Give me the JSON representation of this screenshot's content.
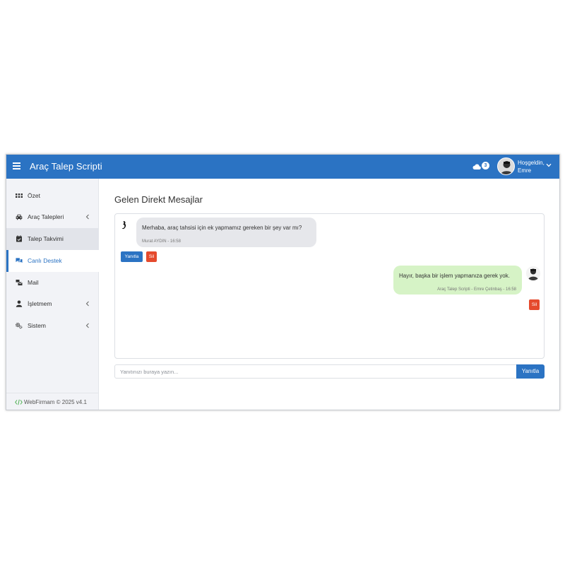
{
  "header": {
    "app_title": "Araç Talep Scripti",
    "notification_count": "3",
    "greeting": "Hoşgeldin,",
    "user_name": "Emre"
  },
  "sidebar": {
    "items": [
      {
        "label": "Özet",
        "icon": "grid-icon"
      },
      {
        "label": "Araç Talepleri",
        "icon": "car-icon",
        "has_submenu": true
      },
      {
        "label": "Talep Takvimi",
        "icon": "calendar-check-icon"
      },
      {
        "label": "Canlı Destek",
        "icon": "chat-icon"
      },
      {
        "label": "Mail",
        "icon": "mail-bulk-icon"
      },
      {
        "label": "İşletmem",
        "icon": "user-icon",
        "has_submenu": true
      },
      {
        "label": "Sistem",
        "icon": "cogs-icon",
        "has_submenu": true
      }
    ],
    "footer": "WebFirmam © 2025 v4.1"
  },
  "main": {
    "title": "Gelen Direkt Mesajlar",
    "messages": [
      {
        "direction": "incoming",
        "text": "Merhaba, araç tahsisi için ek yapmamız gereken bir şey var mı?",
        "meta": "Murat AYDIN - 16:58",
        "reply_label": "Yanıtla",
        "delete_label": "Sil"
      },
      {
        "direction": "outgoing",
        "text": "Hayır, başka bir işlem yapmanıza gerek yok.",
        "meta": "Araç Talep Scripti - Emre Çetinbaş - 16:58",
        "delete_label": "Sil"
      }
    ],
    "reply_placeholder": "Yanıtınızı buraya yazın...",
    "reply_button": "Yanıtla"
  },
  "colors": {
    "primary": "#2b73c3",
    "danger": "#e54a2d",
    "incoming_bubble": "#e6e7eb",
    "outgoing_bubble": "#d6f3c6",
    "sidebar_bg": "#f2f3f7"
  }
}
